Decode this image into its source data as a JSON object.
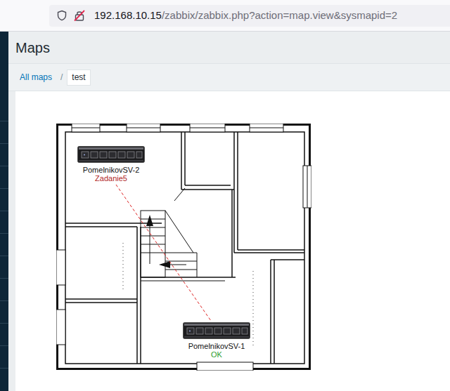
{
  "browser": {
    "url": {
      "host": "192.168.10.15",
      "path": "/zabbix/zabbix.php?action=map.view&sysmapid=2",
      "secure": false
    }
  },
  "page": {
    "title": "Maps"
  },
  "breadcrumbs": {
    "separator": "/",
    "items": [
      {
        "label": "All maps",
        "selected": false
      },
      {
        "label": "test",
        "selected": true
      }
    ]
  },
  "map": {
    "hosts": [
      {
        "name": "PomelnikovSV-2",
        "status": "Zadanie5",
        "color": "#b01e1e"
      },
      {
        "name": "PomelnikovSV-1",
        "status": "OK",
        "color": "#2f9e2f"
      }
    ],
    "links": [
      {
        "from": "PomelnikovSV-2",
        "to": "PomelnikovSV-1",
        "color": "#dd2222"
      }
    ]
  }
}
